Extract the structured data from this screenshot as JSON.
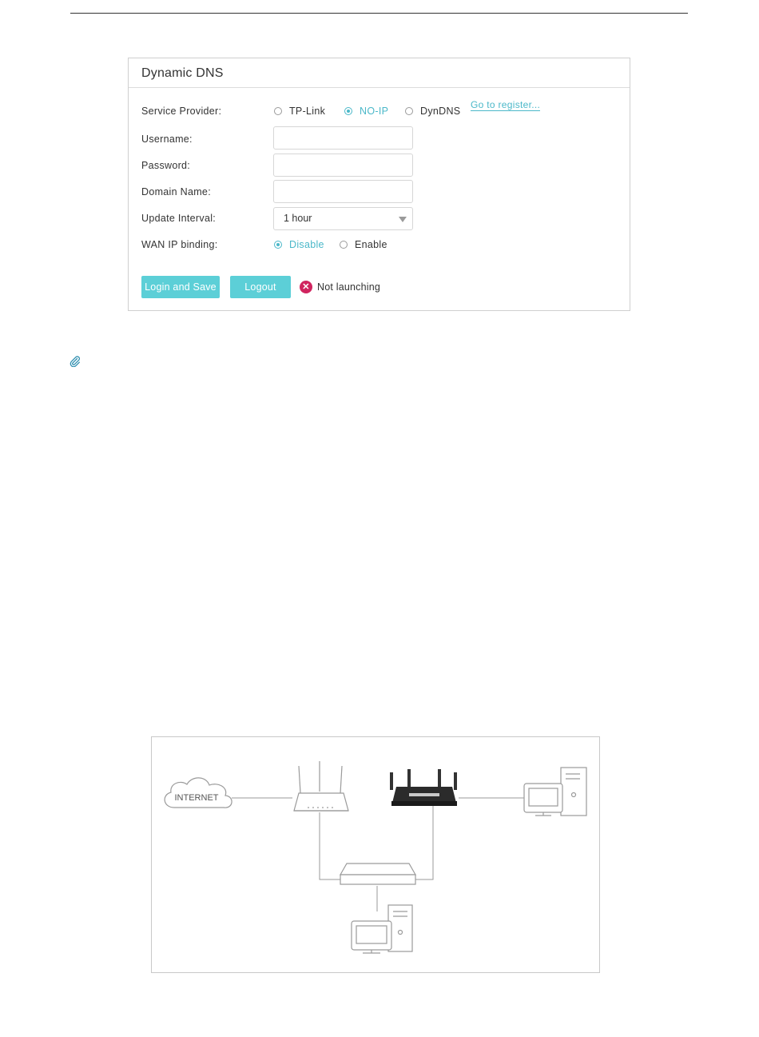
{
  "panel": {
    "title": "Dynamic DNS",
    "service_provider_label": "Service Provider:",
    "providers": [
      {
        "label": "TP-Link",
        "checked": false
      },
      {
        "label": "NO-IP",
        "checked": true
      },
      {
        "label": "DynDNS",
        "checked": false
      }
    ],
    "register_link": "Go to register...",
    "username_label": "Username:",
    "username_value": "",
    "password_label": "Password:",
    "password_value": "",
    "domain_label": "Domain Name:",
    "domain_value": "",
    "interval_label": "Update Interval:",
    "interval_value": "1 hour",
    "wan_label": "WAN IP binding:",
    "wan_options": [
      {
        "label": "Disable",
        "checked": true
      },
      {
        "label": "Enable",
        "checked": false
      }
    ],
    "login_button": "Login and Save",
    "logout_button": "Logout",
    "status_text": "Not launching"
  },
  "diagram": {
    "internet_label": "INTERNET"
  },
  "colors": {
    "accent": "#4bb8c9",
    "button": "#5ccfd7",
    "error": "#d0245f"
  },
  "icons": {
    "note": "paperclip-icon",
    "status": "error-x-icon",
    "dropdown": "chevron-down-icon"
  }
}
